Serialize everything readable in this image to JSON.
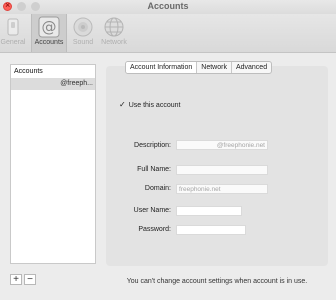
{
  "window": {
    "title": "Accounts"
  },
  "toolbar": {
    "items": [
      {
        "label": "General",
        "icon": "switch-icon"
      },
      {
        "label": "Accounts",
        "icon": "at-sign-icon"
      },
      {
        "label": "Sound",
        "icon": "speaker-icon"
      },
      {
        "label": "Network",
        "icon": "globe-icon"
      }
    ]
  },
  "accounts_list": {
    "header": "Accounts",
    "items": [
      {
        "label": "@freeph..."
      }
    ]
  },
  "tabs": [
    {
      "label": "Account Information"
    },
    {
      "label": "Network"
    },
    {
      "label": "Advanced"
    }
  ],
  "use_account": {
    "label": "Use this account",
    "checked": true,
    "mark": "✓"
  },
  "form": {
    "description": {
      "label": "Description:",
      "value": "@freephonie.net"
    },
    "full_name": {
      "label": "Full Name:",
      "value": ""
    },
    "domain": {
      "label": "Domain:",
      "value": "freephonie.net"
    },
    "user_name": {
      "label": "User Name:",
      "value": ""
    },
    "password": {
      "label": "Password:",
      "value": ""
    }
  },
  "footer": {
    "add_label": "+",
    "remove_label": "−",
    "message": "You can't change account settings when account is in use."
  }
}
